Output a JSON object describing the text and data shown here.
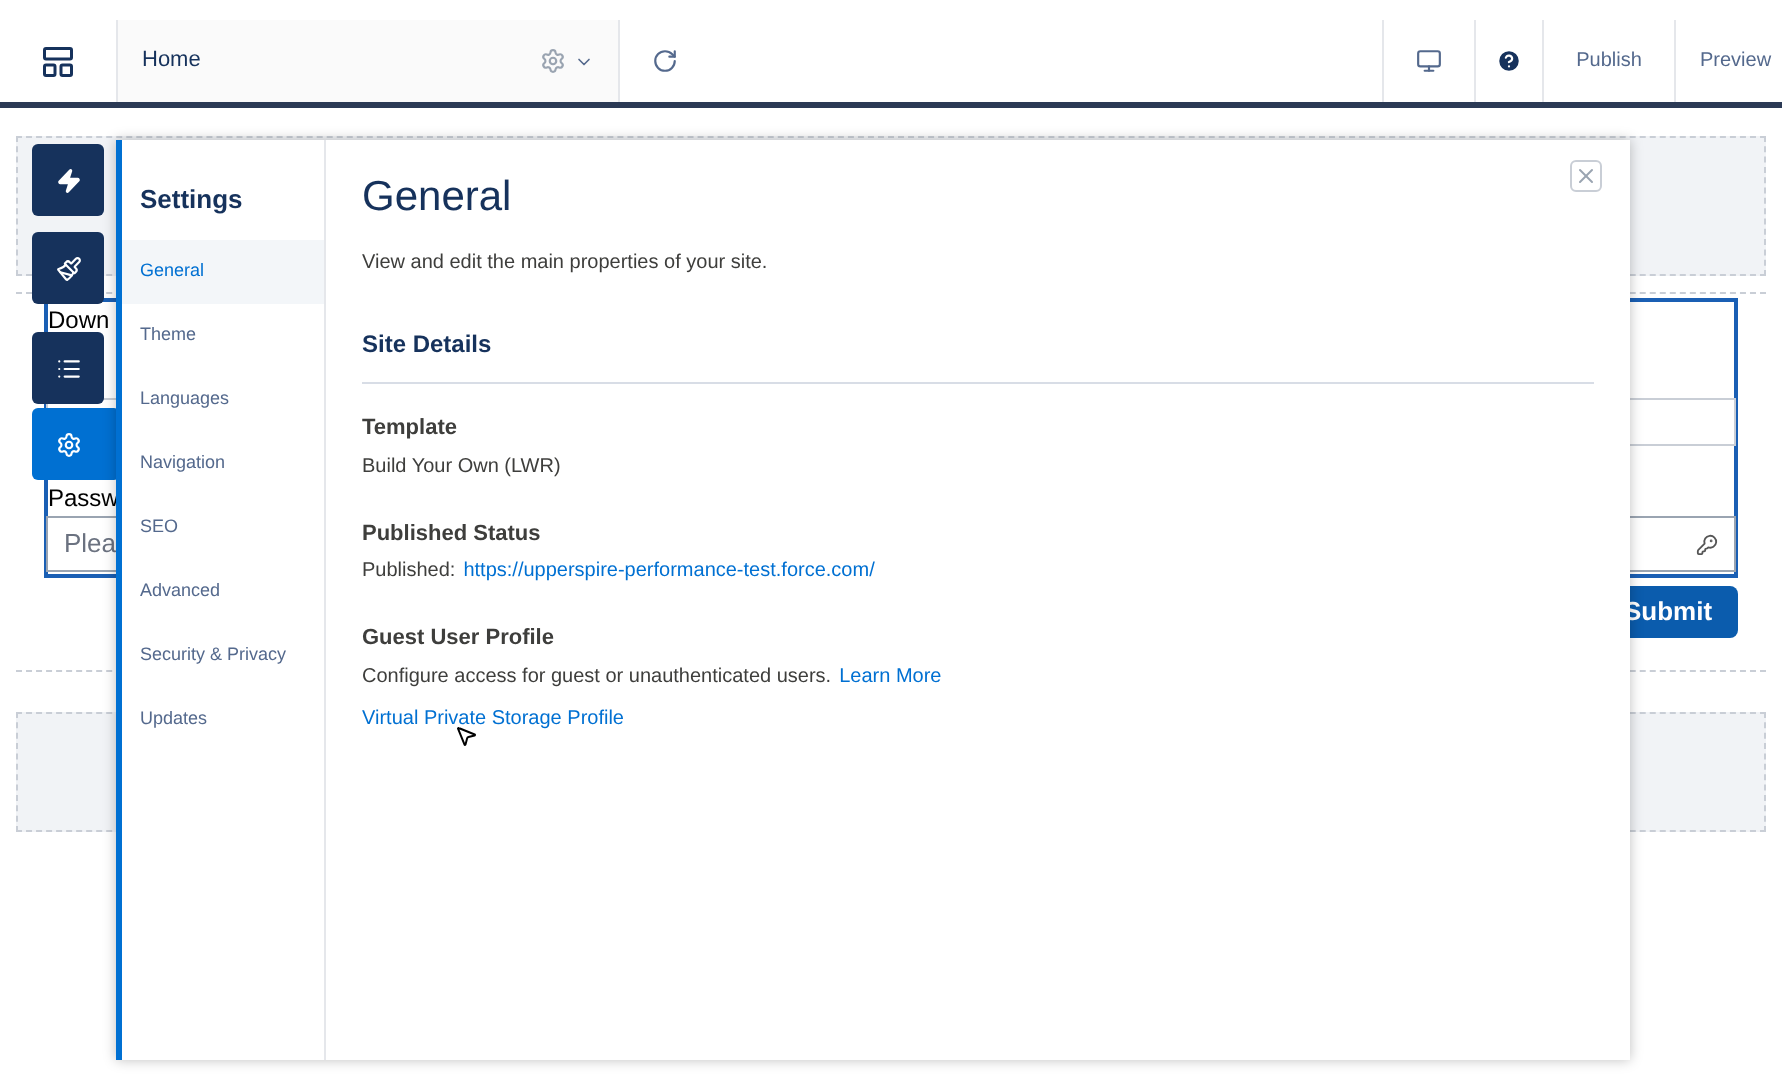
{
  "top_bar": {
    "page": "Home",
    "publish": "Publish",
    "preview": "Preview"
  },
  "tools": [
    {
      "kind": "lightning",
      "selected": false
    },
    {
      "kind": "brush",
      "selected": false
    },
    {
      "kind": "list",
      "selected": false
    },
    {
      "kind": "settings",
      "selected": true
    }
  ],
  "background_form": {
    "label_1": "Down",
    "label_2": "Passw",
    "password_placeholder": "Plea",
    "submit": "Submit"
  },
  "settings": {
    "title": "Settings",
    "nav": [
      {
        "label": "General",
        "selected": true
      },
      {
        "label": "Theme",
        "selected": false
      },
      {
        "label": "Languages",
        "selected": false
      },
      {
        "label": "Navigation",
        "selected": false
      },
      {
        "label": "SEO",
        "selected": false
      },
      {
        "label": "Advanced",
        "selected": false
      },
      {
        "label": "Security & Privacy",
        "selected": false
      },
      {
        "label": "Updates",
        "selected": false
      }
    ],
    "heading": "General",
    "description": "View and edit the main properties of your site.",
    "section": "Site Details",
    "template": {
      "label": "Template",
      "value": "Build Your Own (LWR)"
    },
    "published_status": {
      "label": "Published Status",
      "prefix": "Published:",
      "url": "https://upperspire-performance-test.force.com/"
    },
    "guest_user_profile": {
      "label": "Guest User Profile",
      "text": "Configure access for guest or unauthenticated users.",
      "learn_more": "Learn More",
      "profile_link": "Virtual Private Storage Profile"
    }
  }
}
